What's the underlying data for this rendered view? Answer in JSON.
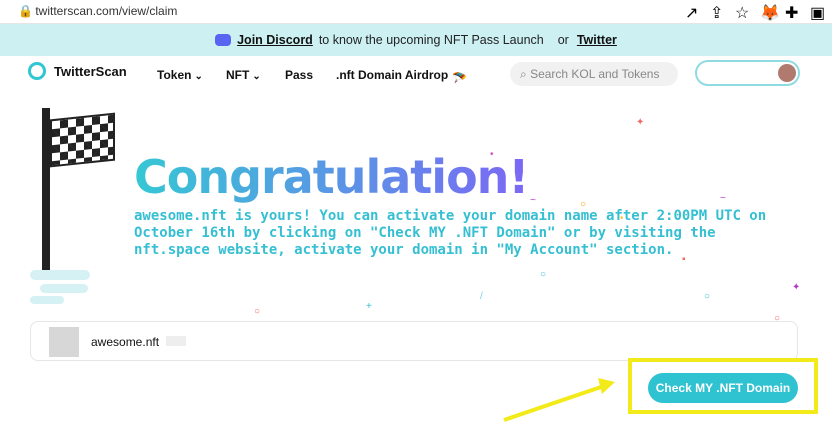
{
  "browser": {
    "url": "twitterscan.com/view/claim"
  },
  "banner": {
    "join_discord": "Join Discord",
    "middle_text": "to know the upcoming NFT Pass Launch",
    "or_text": "or",
    "twitter": "Twitter"
  },
  "nav": {
    "logo_text": "TwitterScan",
    "items": [
      "Token",
      "NFT",
      "Pass",
      ".nft Domain Airdrop"
    ],
    "search_placeholder": "Search KOL and Tokens"
  },
  "hero": {
    "title": "Congratulation!",
    "message": "awesome.nft is yours! You can activate your domain name after 2:00PM UTC on October 16th by clicking on \"Check MY .NFT Domain\" or by visiting the nft.space website, activate your domain in \"My Account\" section."
  },
  "domain_card": {
    "name": "awesome.nft"
  },
  "cta": {
    "label": "Check MY .NFT Domain"
  },
  "colors": {
    "accent": "#2fc2d0",
    "highlight": "#f3ea19"
  }
}
